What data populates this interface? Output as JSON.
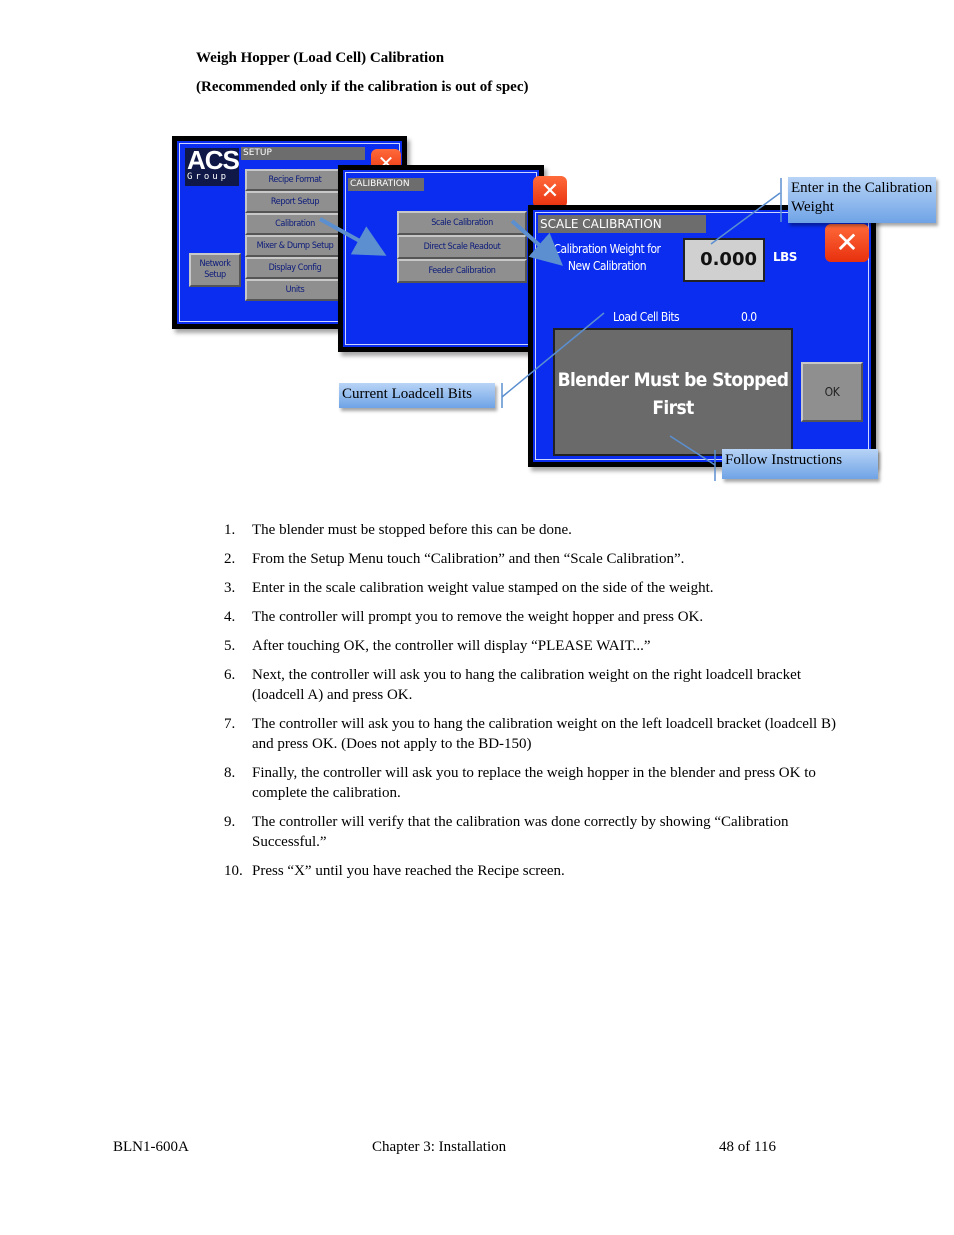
{
  "heading": {
    "title": "Weigh Hopper (Load Cell) Calibration",
    "subtitle": "(Recommended only if the calibration is out of spec)"
  },
  "figure": {
    "setup_screen": {
      "logo_main": "ACS",
      "logo_sub": "Group",
      "title": "SETUP",
      "close_icon": "close-x-icon",
      "menu_buttons": [
        "Recipe Format",
        "Report Setup",
        "Calibration",
        "Mixer & Dump Setup",
        "Display Config",
        "Units"
      ],
      "network_button": "Network Setup"
    },
    "calibration_screen": {
      "title": "CALIBRATION",
      "close_icon": "close-x-icon",
      "buttons": [
        "Scale Calibration",
        "Direct Scale Readout",
        "Feeder Calibration"
      ]
    },
    "scale_calibration_screen": {
      "title": "SCALE CALIBRATION",
      "weight_label_line1": "Calibration Weight for",
      "weight_label_line2": "New Calibration",
      "weight_value": "0.000",
      "weight_unit": "LBS",
      "load_cell_label": "Load Cell Bits",
      "load_cell_value": "0.0",
      "message": "Blender Must be Stopped First",
      "ok_button": "OK",
      "close_icon": "close-x-icon"
    },
    "callouts": {
      "enter_weight": "Enter in the Calibration Weight",
      "current_bits": "Current Loadcell Bits",
      "follow": "Follow Instructions"
    },
    "colors": {
      "screen_blue": "#0a2df0",
      "button_gray": "#8f8f8f",
      "close_red": "#e8300e",
      "callout_blue": "#8fb7ee",
      "arrow_blue": "#5b8fd0"
    }
  },
  "steps": [
    {
      "num": "1.",
      "text": "The blender must be stopped before this can be done."
    },
    {
      "num": "2.",
      "text": "From the Setup Menu touch “Calibration” and then “Scale Calibration”."
    },
    {
      "num": "3.",
      "text": "Enter in the scale calibration weight value stamped on the side of the weight."
    },
    {
      "num": "4.",
      "text": "The controller will prompt you to remove the weight hopper and press OK."
    },
    {
      "num": "5.",
      "text": "After touching OK, the controller will display “PLEASE WAIT...”"
    },
    {
      "num": "6.",
      "text": "Next, the controller will ask you to hang the calibration weight on the right loadcell bracket (loadcell A) and press OK."
    },
    {
      "num": "7.",
      "text": "The controller will ask you to hang the calibration weight on the left loadcell bracket (loadcell B) and press OK. (Does not apply to the BD-150)"
    },
    {
      "num": "8.",
      "text": "Finally, the controller will ask you to replace the weigh hopper in the blender and press OK to complete the calibration."
    },
    {
      "num": "9.",
      "text": "The controller will verify that the calibration was done correctly by showing “Calibration Successful.”"
    },
    {
      "num": "10.",
      "text": "Press “X” until you have reached the Recipe screen."
    }
  ],
  "footer": {
    "doc_id": "BLN1-600A",
    "chapter": "Chapter 3: Installation",
    "page": "48 of 116"
  }
}
